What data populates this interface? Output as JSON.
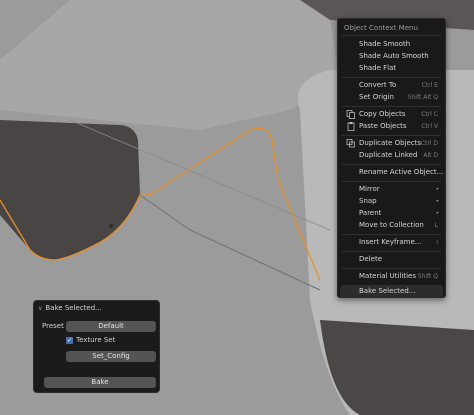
{
  "context_menu": {
    "title": "Object Context Menu",
    "items": [
      {
        "label": "Shade Smooth",
        "shortcut": ""
      },
      {
        "label": "Shade Auto Smooth",
        "shortcut": ""
      },
      {
        "label": "Shade Flat",
        "shortcut": ""
      },
      {
        "label": "Convert To",
        "shortcut": "Ctrl E"
      },
      {
        "label": "Set Origin",
        "shortcut": "Shift Alt Q"
      },
      {
        "label": "Copy Objects",
        "shortcut": "Ctrl C"
      },
      {
        "label": "Paste Objects",
        "shortcut": "Ctrl V"
      },
      {
        "label": "Duplicate Objects",
        "shortcut": "Ctrl D"
      },
      {
        "label": "Duplicate Linked",
        "shortcut": "Alt D"
      },
      {
        "label": "Rename Active Object...",
        "shortcut": ""
      },
      {
        "label": "Mirror",
        "shortcut": "▸"
      },
      {
        "label": "Snap",
        "shortcut": "▸"
      },
      {
        "label": "Parent",
        "shortcut": "▸"
      },
      {
        "label": "Move to Collection",
        "shortcut": "L"
      },
      {
        "label": "Insert Keyframe...",
        "shortcut": "I"
      },
      {
        "label": "Delete",
        "shortcut": ""
      },
      {
        "label": "Material Utilities",
        "shortcut": "Shift Q"
      },
      {
        "label": "Bake Selected...",
        "shortcut": ""
      }
    ]
  },
  "bake_panel": {
    "title": "Bake Selected...",
    "preset_label": "Preset",
    "preset_value": "Default",
    "texture_set_label": "Texture Set",
    "texture_set_checked": true,
    "set_config_label": "Set_Config",
    "bake_label": "Bake"
  },
  "colors": {
    "selection_outline": "#e8902a",
    "menu_bg": "#191919",
    "checkbox": "#4772b3"
  }
}
